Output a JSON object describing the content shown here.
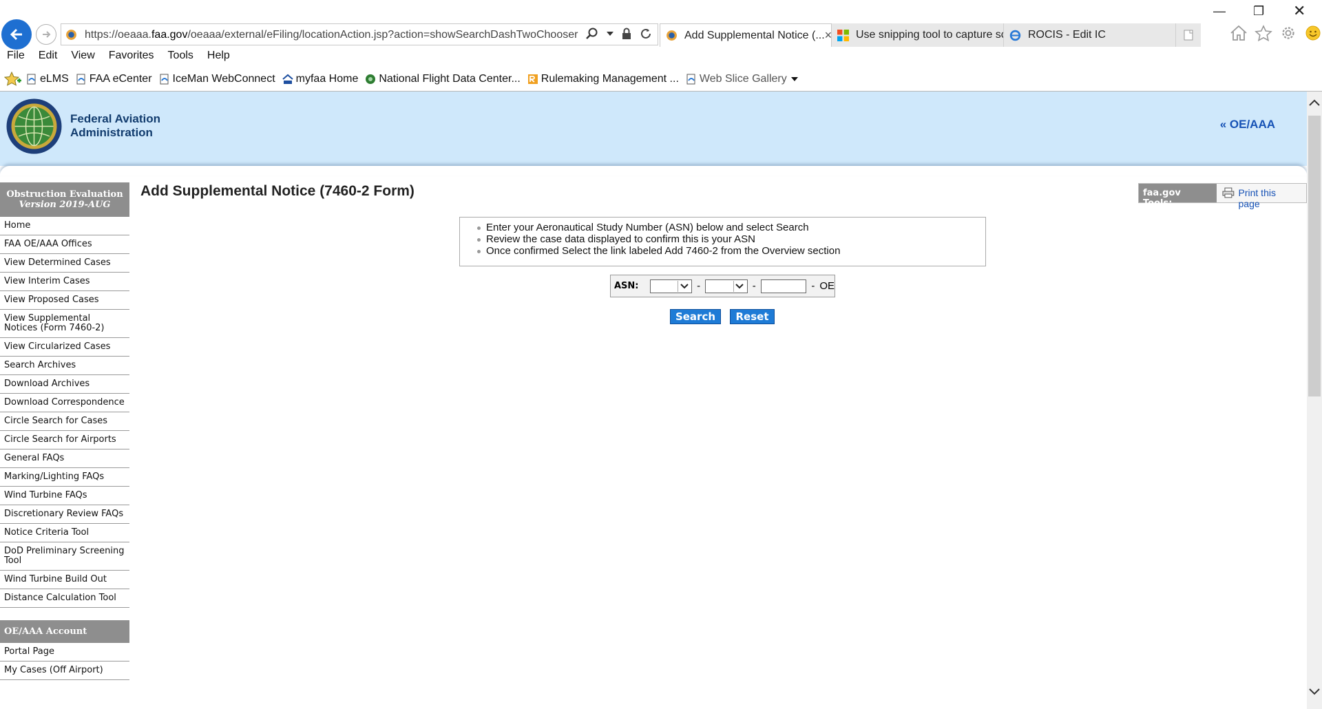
{
  "browser": {
    "url_prefix": "https://oeaaa.",
    "url_domain": "faa.gov",
    "url_suffix": "/oeaaa/external/eFiling/locationAction.jsp?action=showSearchDashTwoChooser",
    "tabs": [
      {
        "label": "Add Supplemental Notice (...",
        "active": true
      },
      {
        "label": "Use snipping tool to capture sc...",
        "active": false
      },
      {
        "label": "ROCIS - Edit IC",
        "active": false
      }
    ],
    "menu": [
      "File",
      "Edit",
      "View",
      "Favorites",
      "Tools",
      "Help"
    ],
    "favorites": [
      "eLMS",
      "FAA eCenter",
      "IceMan WebConnect",
      "myfaa Home",
      "National Flight Data Center...",
      "Rulemaking Management ...",
      "Web Slice Gallery"
    ]
  },
  "header": {
    "agency_line1": "Federal Aviation",
    "agency_line2": "Administration",
    "oeaaa_link": "« OE/AAA"
  },
  "sidebar": {
    "heading_line1": "Obstruction Evaluation",
    "heading_line2": "Version 2019-AUG",
    "items": [
      "Home",
      "FAA OE/AAA Offices",
      "View Determined Cases",
      "View Interim Cases",
      "View Proposed Cases",
      "View Supplemental Notices (Form 7460-2)",
      "View Circularized Cases",
      "Search Archives",
      "Download Archives",
      "Download Correspondence",
      "Circle Search for Cases",
      "Circle Search for Airports",
      "General FAQs",
      "Marking/Lighting FAQs",
      "Wind Turbine FAQs",
      "Discretionary Review FAQs",
      "Notice Criteria Tool",
      "DoD Preliminary Screening Tool",
      "Wind Turbine Build Out",
      "Distance Calculation Tool"
    ],
    "account_heading": "OE/AAA Account",
    "account_items": [
      "Portal Page",
      "My Cases (Off Airport)"
    ]
  },
  "main": {
    "title": "Add Supplemental Notice (7460-2 Form)",
    "tools_label": "faa.gov Tools:",
    "print_label": "Print this page",
    "instructions": [
      "Enter your Aeronautical Study Number (ASN) below and select Search",
      "Review the case data displayed to confirm this is your ASN",
      "Once confirmed Select the link labeled Add 7460-2 from the Overview section"
    ],
    "asn_label": "ASN:",
    "asn_suffix": "OE",
    "search_button": "Search",
    "reset_button": "Reset"
  }
}
